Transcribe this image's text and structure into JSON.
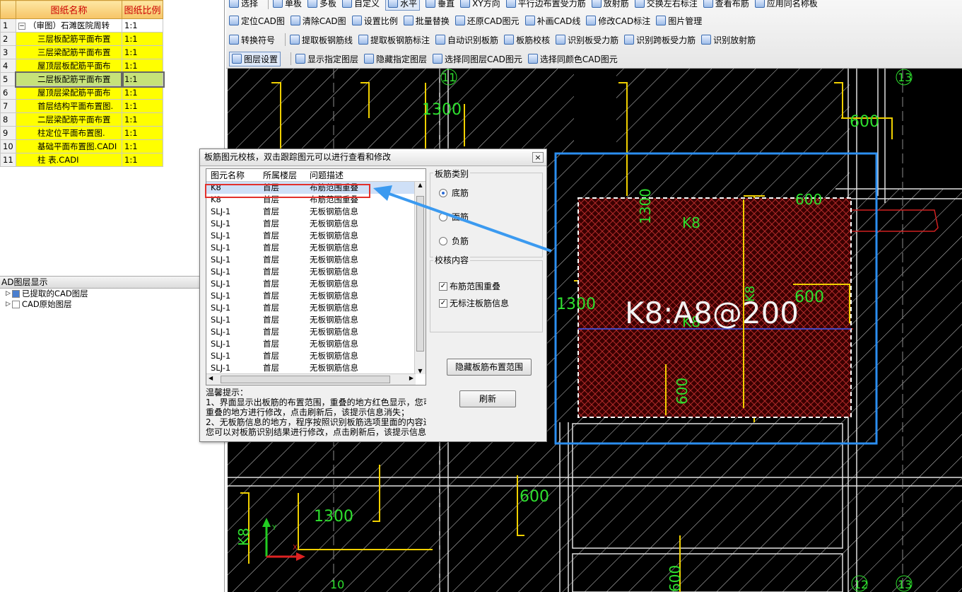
{
  "toolbar": {
    "row1": [
      "选择",
      "单板",
      "多板",
      "自定义",
      "水平",
      "垂直",
      "XY方向",
      "平行边布置受力筋",
      "放射筋",
      "交换左右标注",
      "查看布筋",
      "应用同名称板"
    ],
    "row2": [
      "定位CAD图",
      "清除CAD图",
      "设置比例",
      "批量替换",
      "还原CAD图元",
      "补画CAD线",
      "修改CAD标注",
      "图片管理"
    ],
    "row3": [
      "转换符号",
      "提取板钢筋线",
      "提取板钢筋标注",
      "自动识别板筋",
      "板筋校核",
      "识别板受力筋",
      "识别跨板受力筋",
      "识别放射筋"
    ],
    "row4": [
      "图层设置",
      "显示指定图层",
      "隐藏指定图层",
      "选择同图层CAD图元",
      "选择同颜色CAD图元"
    ]
  },
  "drawing_list": {
    "header_name": "图纸名称",
    "header_scale": "图纸比例",
    "rows": [
      {
        "idx": "1",
        "name": "（审图）石濉医院周转",
        "scale": "1:1",
        "expander": "−"
      },
      {
        "idx": "2",
        "name": "三层板配筋平面布置",
        "scale": "1:1"
      },
      {
        "idx": "3",
        "name": "三层梁配筋平面布置",
        "scale": "1:1"
      },
      {
        "idx": "4",
        "name": "屋顶层板配筋平面布",
        "scale": "1:1"
      },
      {
        "idx": "5",
        "name": "二层板配筋平面布置",
        "scale": "1:1"
      },
      {
        "idx": "6",
        "name": "屋顶层梁配筋平面布",
        "scale": "1:1"
      },
      {
        "idx": "7",
        "name": "首层结构平面布置图.",
        "scale": "1:1"
      },
      {
        "idx": "8",
        "name": "二层梁配筋平面布置",
        "scale": "1:1"
      },
      {
        "idx": "9",
        "name": "柱定位平面布置图.",
        "scale": "1:1"
      },
      {
        "idx": "10",
        "name": "基础平面布置图.CADI",
        "scale": "1:1"
      },
      {
        "idx": "11",
        "name": "柱 表.CADI",
        "scale": "1:1"
      }
    ]
  },
  "layer_panel": {
    "title": "AD图层显示",
    "items": [
      "已提取的CAD图层",
      "CAD原始图层"
    ]
  },
  "dialog": {
    "title": "板筋图元校核，双击跟踪图元可以进行查看和修改",
    "close": "×",
    "columns": [
      "图元名称",
      "所属楼层",
      "问题描述"
    ],
    "rows": [
      [
        "K8",
        "首层",
        "布筋范围重叠"
      ],
      [
        "K8",
        "首层",
        "布筋范围重叠"
      ],
      [
        "SLJ-1",
        "首层",
        "无板钢筋信息"
      ],
      [
        "SLJ-1",
        "首层",
        "无板钢筋信息"
      ],
      [
        "SLJ-1",
        "首层",
        "无板钢筋信息"
      ],
      [
        "SLJ-1",
        "首层",
        "无板钢筋信息"
      ],
      [
        "SLJ-1",
        "首层",
        "无板钢筋信息"
      ],
      [
        "SLJ-1",
        "首层",
        "无板钢筋信息"
      ],
      [
        "SLJ-1",
        "首层",
        "无板钢筋信息"
      ],
      [
        "SLJ-1",
        "首层",
        "无板钢筋信息"
      ],
      [
        "SLJ-1",
        "首层",
        "无板钢筋信息"
      ],
      [
        "SLJ-1",
        "首层",
        "无板钢筋信息"
      ],
      [
        "SLJ-1",
        "首层",
        "无板钢筋信息"
      ],
      [
        "SLJ-1",
        "首层",
        "无板钢筋信息"
      ],
      [
        "SLJ-1",
        "首层",
        "无板钢筋信息"
      ],
      [
        "SLJ-1",
        "首层",
        "无板钢筋信息"
      ]
    ],
    "hint_lines": [
      "温馨提示：",
      "1、界面显示出板筋的布置范围，重叠的地方红色显示，您可",
      "重叠的地方进行修改，点击刷新后，该提示信息消失；",
      "2、无板筋信息的地方，程序按照识别板筋选项里面的内容进",
      "您可以对板筋识别结果进行修改，点击刷新后，该提示信息"
    ],
    "rebar_type_title": "板筋类别",
    "rebar_types": [
      "底筋",
      "面筋",
      "负筋"
    ],
    "check_title": "校核内容",
    "checks": [
      "布筋范围重叠",
      "无标注板筋信息"
    ],
    "hide_button": "隐藏板筋布置范围",
    "refresh_button": "刷新"
  },
  "cad": {
    "dims": [
      "1300",
      "600",
      "600",
      "600",
      "1300",
      "600",
      "1300",
      "600",
      "1300",
      "600"
    ],
    "labels": [
      "K8",
      "K8",
      "K8",
      "K8"
    ],
    "main_label": "K8:A8@200",
    "axis_nums": [
      "11",
      "13",
      "10",
      "12",
      "13"
    ],
    "axis_x": "X",
    "axis_y": "Y"
  }
}
